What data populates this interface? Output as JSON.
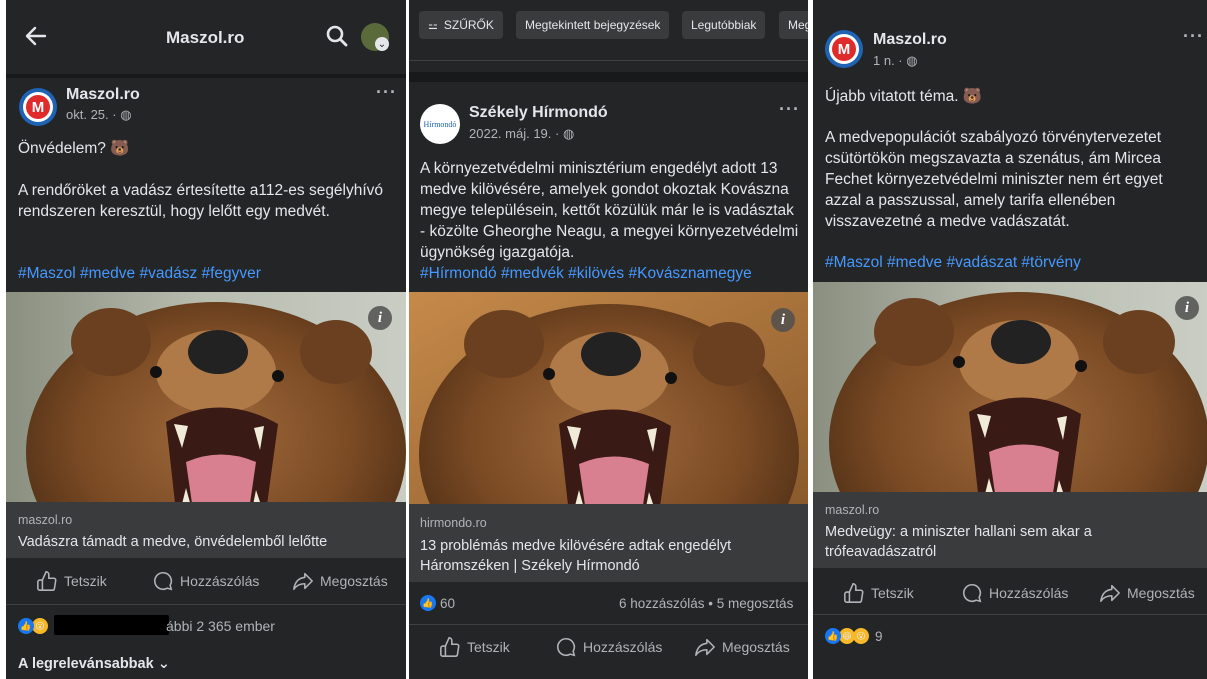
{
  "panel1": {
    "header": {
      "title": "Maszol.ro"
    },
    "post": {
      "page_name": "Maszol.ro",
      "date": "okt. 25. · ",
      "line1": "Önvédelem? 🐻",
      "body": "A rendőröket a vadász értesítette a112-es segélyhívó rendszeren keresztül, hogy lelőtt egy medvét.",
      "hashtags": "#Maszol #medve #vadász #fegyver",
      "link_domain": "maszol.ro",
      "link_title": "Vadászra támadt a medve, önvédelemből lelőtte"
    },
    "actions": {
      "like": "Tetszik",
      "comment": "Hozzászólás",
      "share": "Megosztás"
    },
    "reactions_text": "ábbi 2 365 ember",
    "sort_label": "A legrelevánsabbak ⌄"
  },
  "panel2": {
    "filters": {
      "filters_label": "SZŰRŐK",
      "viewed": "Megtekintett bejegyzések",
      "recent": "Legutóbbiak",
      "more": "Meg"
    },
    "post": {
      "page_name": "Székely Hírmondó",
      "avatar_text": "Hírmondó",
      "date": "2022. máj. 19. · ",
      "body": "A környezetvédelmi minisztérium engedélyt adott 13 medve kilövésére, amelyek gondot okoztak Kovászna megye településein, kettőt közülük már le is vadásztak - közölte Gheorghe Neagu, a megyei környezetvédelmi ügynökség igazgatója.",
      "hashtags": "#Hírmondó #medvék #kilövés #Kovásznamegye",
      "link_domain": "hirmondo.ro",
      "link_title": "13 problémás medve kilövésére adtak engedélyt Háromszéken | Székely Hírmondó"
    },
    "stats": {
      "likes": "60",
      "comments_shares": "6 hozzászólás • 5 megosztás"
    },
    "actions": {
      "like": "Tetszik",
      "comment": "Hozzászólás",
      "share": "Megosztás"
    }
  },
  "panel3": {
    "post": {
      "page_name": "Maszol.ro",
      "date": "1 n. · ",
      "line1": "Újabb vitatott téma. 🐻",
      "body": "A medvepopulációt szabályozó törvénytervezetet csütörtökön megszavazta a szenátus, ám Mircea Fechet  környezetvédelmi  miniszter nem ért egyet azzal a passzussal, amely tarifa ellenében visszavezetné a medve vadászatát.",
      "hashtags": "#Maszol #medve #vadászat #törvény",
      "link_domain": "maszol.ro",
      "link_title": "Medveügy: a miniszter hallani sem akar a trófeavadászatról"
    },
    "actions": {
      "like": "Tetszik",
      "comment": "Hozzászólás",
      "share": "Megosztás"
    },
    "reactions_count": "9"
  },
  "colors": {
    "bg": "#242526",
    "text": "#e4e6eb",
    "muted": "#b0b3b8",
    "link": "#4599ff",
    "card": "#3a3b3c"
  }
}
